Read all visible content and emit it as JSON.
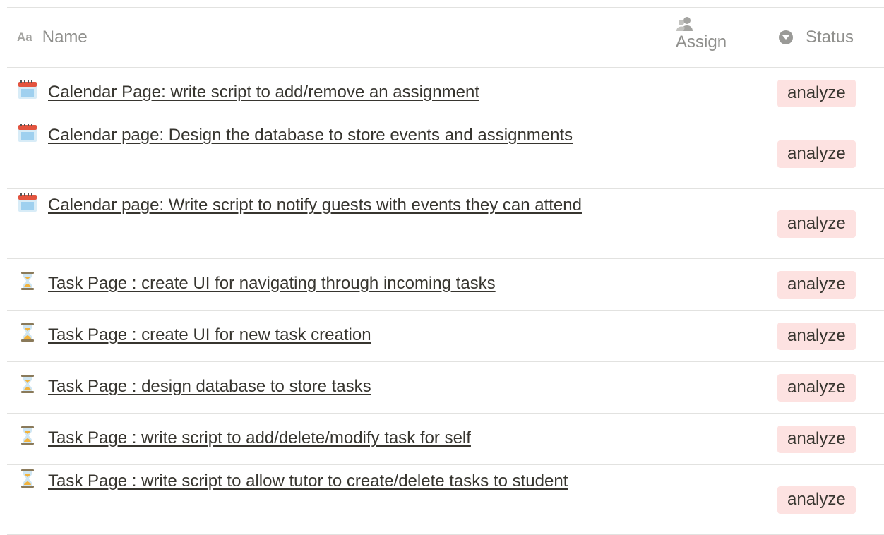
{
  "headers": {
    "name": "Name",
    "name_icon": "Aa",
    "assign": "Assign",
    "status": "Status"
  },
  "rows": [
    {
      "icon": "calendar-icon",
      "title": "Calendar Page: write script to add/remove an assignment",
      "assign": "",
      "status": "analyze"
    },
    {
      "icon": "calendar-icon",
      "title": "Calendar page: Design the database to store events and assignments",
      "assign": "",
      "status": "analyze"
    },
    {
      "icon": "calendar-icon",
      "title": "Calendar page: Write script to notify guests with events they can attend",
      "assign": "",
      "status": "analyze"
    },
    {
      "icon": "hourglass-icon",
      "title": "Task Page : create UI for navigating through incoming tasks",
      "assign": "",
      "status": "analyze"
    },
    {
      "icon": "hourglass-icon",
      "title": "Task Page : create UI for new task creation",
      "assign": "",
      "status": "analyze"
    },
    {
      "icon": "hourglass-icon",
      "title": "Task Page : design database to store tasks",
      "assign": "",
      "status": "analyze"
    },
    {
      "icon": "hourglass-icon",
      "title": "Task Page : write script to add/delete/modify task for self",
      "assign": "",
      "status": "analyze"
    },
    {
      "icon": "hourglass-icon",
      "title": "Task Page : write script to allow tutor to create/delete tasks to student",
      "assign": "",
      "status": "analyze"
    }
  ],
  "colors": {
    "status_badge_bg": "#fde2e1",
    "grid_line": "#e2e2e0",
    "header_text": "#8f8f8c"
  }
}
